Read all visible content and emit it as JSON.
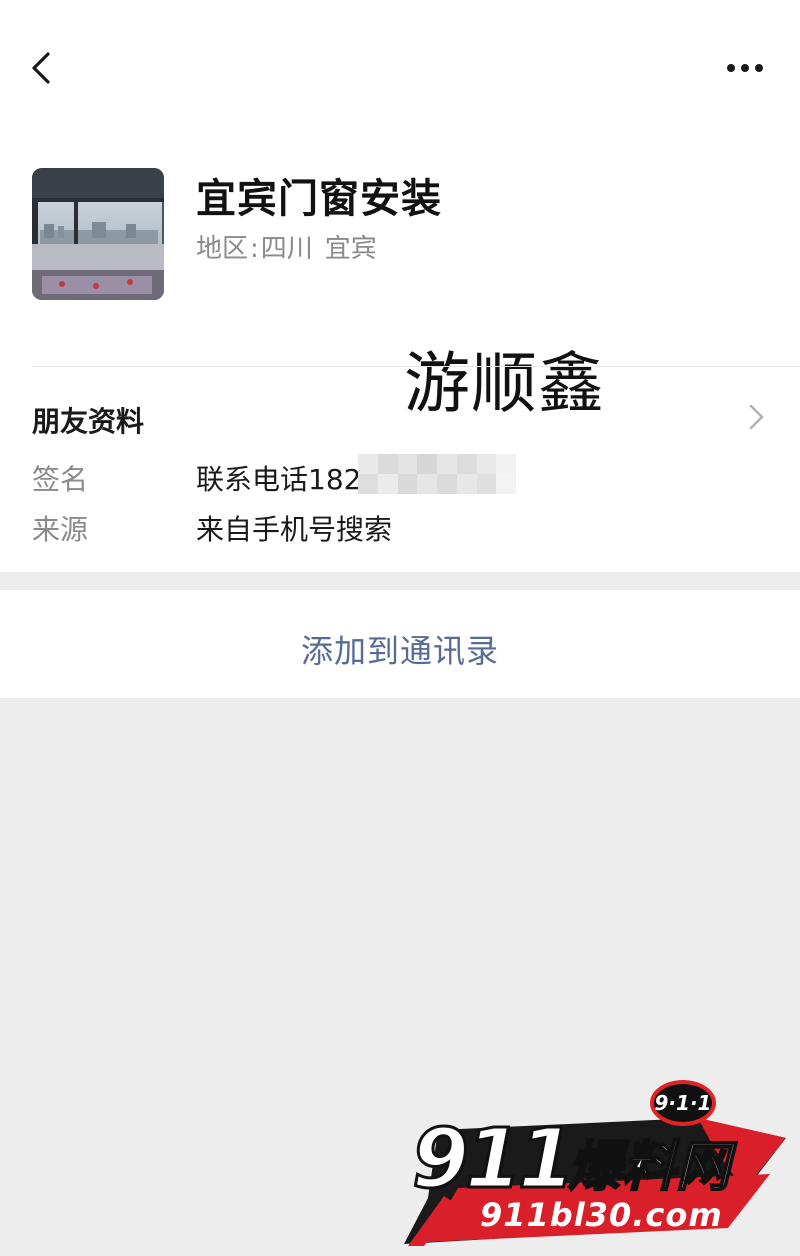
{
  "nav": {
    "back_icon": "chevron-left-icon",
    "more_icon": "more-horizontal-icon"
  },
  "contact": {
    "name": "宜宾门窗安装",
    "region_label": "地区",
    "region_sep": ":",
    "region_province": "四川",
    "region_city": "宜宾"
  },
  "overlay_text": "游顺鑫",
  "profile": {
    "title": "朋友资料",
    "signature_label": "签名",
    "signature_value": "联系电话182",
    "source_label": "来源",
    "source_value": "来自手机号搜索"
  },
  "actions": {
    "add_to_contacts": "添加到通讯录"
  },
  "watermark": {
    "badge": "9·1·1",
    "number": "911",
    "brand": "爆料网",
    "url": "911bl30.com"
  },
  "colors": {
    "link_blue": "#576b95",
    "page_bg": "#ededed",
    "watermark_red": "#e02424"
  }
}
